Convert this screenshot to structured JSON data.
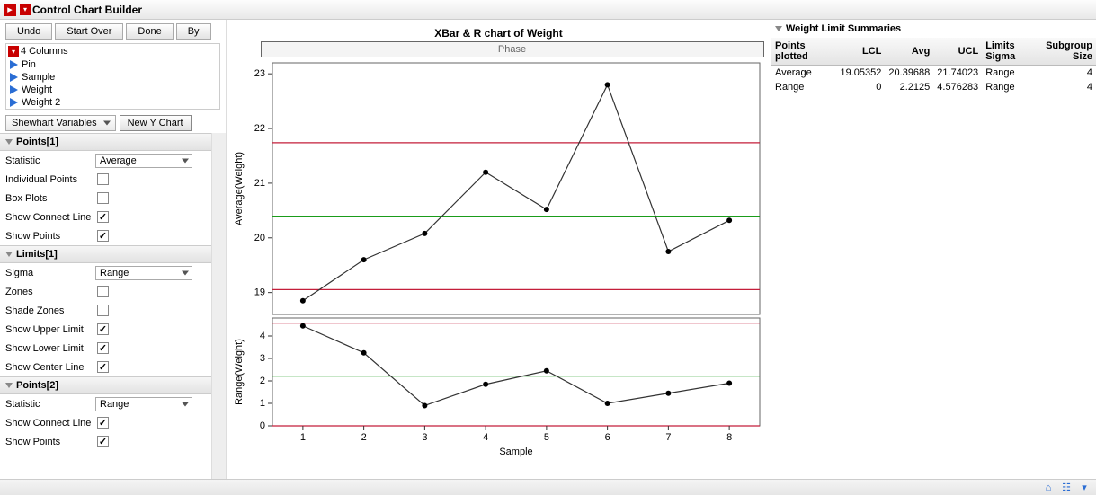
{
  "header": {
    "title": "Control Chart Builder"
  },
  "toolbar": {
    "undo": "Undo",
    "start_over": "Start Over",
    "done": "Done",
    "by": "By"
  },
  "columns": {
    "header": "4 Columns",
    "items": [
      "Pin",
      "Sample",
      "Weight",
      "Weight 2"
    ]
  },
  "chart_type": {
    "label": "Shewhart Variables",
    "new_chart": "New Y Chart"
  },
  "sections": {
    "points1": {
      "title": "Points[1]",
      "statistic_label": "Statistic",
      "statistic_value": "Average",
      "individual_label": "Individual Points",
      "individual_checked": false,
      "box_label": "Box Plots",
      "box_checked": false,
      "connect_label": "Show Connect Line",
      "connect_checked": true,
      "show_pts_label": "Show Points",
      "show_pts_checked": true
    },
    "limits1": {
      "title": "Limits[1]",
      "sigma_label": "Sigma",
      "sigma_value": "Range",
      "zones_label": "Zones",
      "zones_checked": false,
      "shade_label": "Shade Zones",
      "shade_checked": false,
      "upper_label": "Show Upper Limit",
      "upper_checked": true,
      "lower_label": "Show Lower Limit",
      "lower_checked": true,
      "center_label": "Show Center Line",
      "center_checked": true
    },
    "points2": {
      "title": "Points[2]",
      "statistic_label": "Statistic",
      "statistic_value": "Range",
      "connect_label": "Show Connect Line",
      "connect_checked": true,
      "show_pts_label": "Show Points",
      "show_pts_checked": true
    }
  },
  "chart": {
    "title": "XBar & R chart of Weight",
    "phase_label": "Phase",
    "x_axis": "Sample",
    "y_axis_top": "Average(Weight)",
    "y_axis_bottom": "Range(Weight)"
  },
  "summaries": {
    "title": "Weight Limit Summaries",
    "columns": {
      "col0": "Points plotted",
      "col1": "LCL",
      "col2": "Avg",
      "col3": "UCL",
      "col4": "Limits Sigma",
      "col5_a": "Subgroup",
      "col5_b": "Size"
    },
    "rows": {
      "avg": {
        "label": "Average",
        "lcl": "19.05352",
        "avg": "20.39688",
        "ucl": "21.74023",
        "sigma": "Range",
        "size": "4"
      },
      "rng": {
        "label": "Range",
        "lcl": "0",
        "avg": "2.2125",
        "ucl": "4.576283",
        "sigma": "Range",
        "size": "4"
      }
    }
  },
  "chart_data": [
    {
      "type": "line",
      "name": "XBar",
      "x": [
        1,
        2,
        3,
        4,
        5,
        6,
        7,
        8
      ],
      "values": [
        18.85,
        19.6,
        20.08,
        21.2,
        20.52,
        22.8,
        19.75,
        20.32
      ],
      "ylim": [
        18.6,
        23.2
      ],
      "y_ticks": [
        19,
        20,
        21,
        22,
        23
      ],
      "center_line": 20.39688,
      "ucl": 21.74023,
      "lcl": 19.05352,
      "ylabel": "Average(Weight)",
      "xlabel": "Sample"
    },
    {
      "type": "line",
      "name": "R",
      "x": [
        1,
        2,
        3,
        4,
        5,
        6,
        7,
        8
      ],
      "values": [
        4.45,
        3.25,
        0.9,
        1.85,
        2.45,
        1.0,
        1.45,
        1.9
      ],
      "ylim": [
        0,
        4.8
      ],
      "y_ticks": [
        0,
        1,
        2,
        3,
        4
      ],
      "center_line": 2.2125,
      "ucl": 4.576283,
      "lcl": 0,
      "ylabel": "Range(Weight)",
      "xlabel": "Sample"
    }
  ]
}
